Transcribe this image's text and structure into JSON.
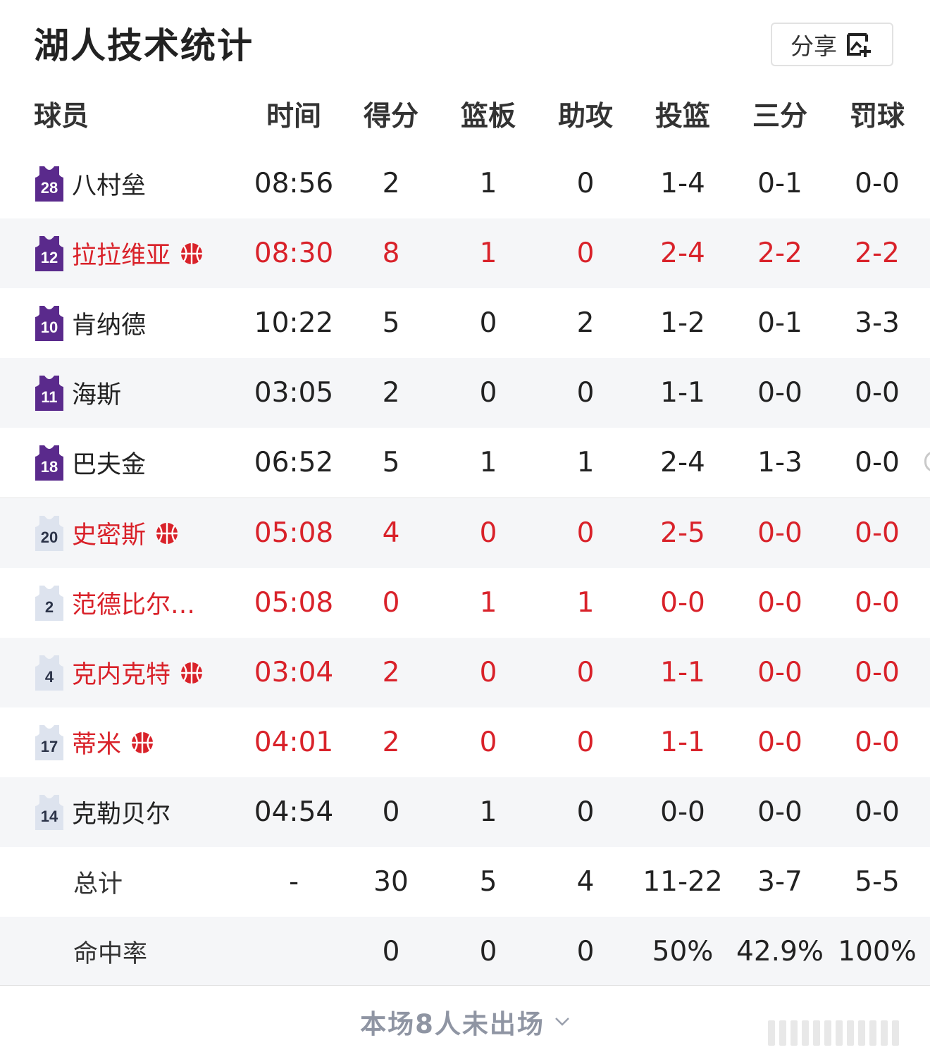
{
  "header": {
    "title": "湖人技术统计",
    "share_label": "分享"
  },
  "columns": {
    "player": "球员",
    "time": "时间",
    "pts": "得分",
    "reb": "篮板",
    "ast": "助攻",
    "fg": "投篮",
    "tp": "三分",
    "ft": "罚球"
  },
  "players": [
    {
      "number": "28",
      "name": "八村垒",
      "time": "08:56",
      "pts": "2",
      "reb": "1",
      "ast": "0",
      "fg": "1-4",
      "tp": "0-1",
      "ft": "0-0"
    },
    {
      "number": "12",
      "name": "拉拉维亚",
      "time": "08:30",
      "pts": "8",
      "reb": "1",
      "ast": "0",
      "fg": "2-4",
      "tp": "2-2",
      "ft": "2-2"
    },
    {
      "number": "10",
      "name": "肯纳德",
      "time": "10:22",
      "pts": "5",
      "reb": "0",
      "ast": "2",
      "fg": "1-2",
      "tp": "0-1",
      "ft": "3-3"
    },
    {
      "number": "11",
      "name": "海斯",
      "time": "03:05",
      "pts": "2",
      "reb": "0",
      "ast": "0",
      "fg": "1-1",
      "tp": "0-0",
      "ft": "0-0"
    },
    {
      "number": "18",
      "name": "巴夫金",
      "time": "06:52",
      "pts": "5",
      "reb": "1",
      "ast": "1",
      "fg": "2-4",
      "tp": "1-3",
      "ft": "0-0"
    },
    {
      "number": "20",
      "name": "史密斯",
      "time": "05:08",
      "pts": "4",
      "reb": "0",
      "ast": "0",
      "fg": "2-5",
      "tp": "0-0",
      "ft": "0-0"
    },
    {
      "number": "2",
      "name": "范德比尔…",
      "time": "05:08",
      "pts": "0",
      "reb": "1",
      "ast": "1",
      "fg": "0-0",
      "tp": "0-0",
      "ft": "0-0"
    },
    {
      "number": "4",
      "name": "克内克特",
      "time": "03:04",
      "pts": "2",
      "reb": "0",
      "ast": "0",
      "fg": "1-1",
      "tp": "0-0",
      "ft": "0-0"
    },
    {
      "number": "17",
      "name": "蒂米",
      "time": "04:01",
      "pts": "2",
      "reb": "0",
      "ast": "0",
      "fg": "1-1",
      "tp": "0-0",
      "ft": "0-0"
    },
    {
      "number": "14",
      "name": "克勒贝尔",
      "time": "04:54",
      "pts": "0",
      "reb": "1",
      "ast": "0",
      "fg": "0-0",
      "tp": "0-0",
      "ft": "0-0"
    }
  ],
  "totals": {
    "label": "总计",
    "time": "-",
    "pts": "30",
    "reb": "5",
    "ast": "4",
    "fg": "11-22",
    "tp": "3-7",
    "ft": "5-5"
  },
  "rates": {
    "label": "命中率",
    "pts": "0",
    "reb": "0",
    "ast": "0",
    "fg": "50%",
    "tp": "42.9%",
    "ft": "100%"
  },
  "footer": {
    "text": "本场8人未出场"
  },
  "colors": {
    "highlight": "#d9222a",
    "jersey_purple": "#5a2a8c",
    "jersey_white": "#dde3ee",
    "alt_row": "#f5f6f8"
  },
  "icons": {
    "share": "share-image-icon",
    "hot": "basketball-icon",
    "expand": "chevron-down-icon"
  }
}
